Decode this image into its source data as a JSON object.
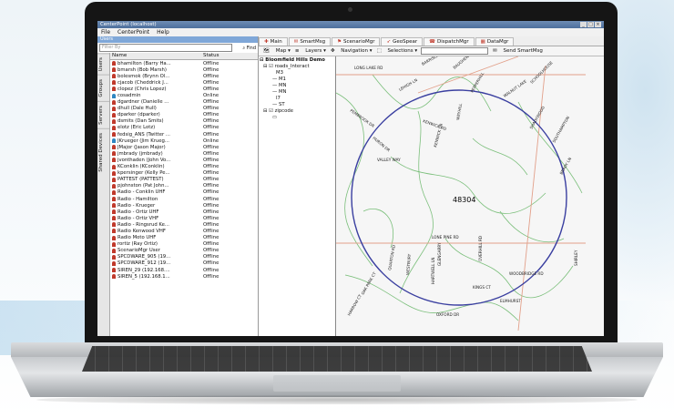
{
  "window": {
    "title": "CenterPoint (localhost)"
  },
  "menu": [
    "File",
    "CenterPoint",
    "Help"
  ],
  "left_panel": {
    "header": "Users",
    "search_placeholder": "Filter By",
    "find_label": "Find",
    "side_tabs": [
      "Users",
      "Groups",
      "Servers",
      "Shared Devices"
    ],
    "columns": [
      "Name",
      "Status"
    ],
    "users": [
      {
        "name": "bhamilton (Barry Ha...",
        "status": "Offline"
      },
      {
        "name": "bmarsh (Bob Marsh)",
        "status": "Offline"
      },
      {
        "name": "bolesmok (Brynn Ol...",
        "status": "Offline"
      },
      {
        "name": "cjacob (Cheddrick J...",
        "status": "Offline"
      },
      {
        "name": "clopez (Chris Lopez)",
        "status": "Offline"
      },
      {
        "name": "cosadmin",
        "status": "Online"
      },
      {
        "name": "dgardner (Danielle ...",
        "status": "Offline"
      },
      {
        "name": "dhull (Dale Hull)",
        "status": "Offline"
      },
      {
        "name": "dparker (dparker)",
        "status": "Offline"
      },
      {
        "name": "dsmits (Dan Smits)",
        "status": "Offline"
      },
      {
        "name": "elotz (Eric Lotz)",
        "status": "Offline"
      },
      {
        "name": "fedsig_ANS (Twitter ...",
        "status": "Offline"
      },
      {
        "name": "JKrueger (Jim Krueg...",
        "status": "Online"
      },
      {
        "name": "JMajor (Jason Major)",
        "status": "Offline"
      },
      {
        "name": "jmbrady (jmbrady)",
        "status": "Offline"
      },
      {
        "name": "jvonthaden (John Vo...",
        "status": "Offline"
      },
      {
        "name": "KConklin (KConklin)",
        "status": "Offline"
      },
      {
        "name": "kpersinger (Kelly Pe...",
        "status": "Offline"
      },
      {
        "name": "PATTEST (PATTEST)",
        "status": "Offline"
      },
      {
        "name": "pjohnston (Pat John...",
        "status": "Offline"
      },
      {
        "name": "Radio - Conklin UHF",
        "status": "Offline"
      },
      {
        "name": "Radio - Hamilton",
        "status": "Offline"
      },
      {
        "name": "Radio - Krueger",
        "status": "Offline"
      },
      {
        "name": "Radio - Ortiz UHF",
        "status": "Offline"
      },
      {
        "name": "Radio - Ortiz VHF",
        "status": "Offline"
      },
      {
        "name": "Radio - Ringsrud Ke...",
        "status": "Offline"
      },
      {
        "name": "Radio Kenwood VHF",
        "status": "Offline"
      },
      {
        "name": "Radio Moto UHF",
        "status": "Offline"
      },
      {
        "name": "rortiz (Ray Ortiz)",
        "status": "Offline"
      },
      {
        "name": "ScenarioMgr User",
        "status": "Offline"
      },
      {
        "name": "SPCDWARE_905 (19...",
        "status": "Offline"
      },
      {
        "name": "SPCDWARE_912 (19...",
        "status": "Offline"
      },
      {
        "name": "SIREN_29 (192.168....",
        "status": "Offline"
      },
      {
        "name": "SIREN_5 (192.168.1...",
        "status": "Offline"
      }
    ]
  },
  "tabs": [
    "Main",
    "SmartMsg",
    "ScenarioMgr",
    "GeoSpear",
    "DispatchMgr",
    "DataMgr"
  ],
  "toolbar": {
    "map": "Map",
    "layers": "Layers",
    "navigation": "Navigation",
    "selections": "Selections",
    "send": "Send SmartMsg"
  },
  "layers": [
    "Bloomfield Hills Demo",
    "roads_Interact",
    "M3",
    "M1",
    "MN",
    "MN",
    "I7",
    "ST",
    "zipcode"
  ],
  "map": {
    "zip": "48304",
    "labels": [
      "LONG LAKE RD",
      "BARRISON LN",
      "BAUGHEN CT",
      "SCHOOLHOUSE",
      "LEHIGH LN",
      "PEPPERHILL",
      "WALNUT LAKE",
      "PEMBROOK DR",
      "KENWICK RD",
      "WEYHILL",
      "HURON DR",
      "KENWICK DR",
      "SHADYWOOD",
      "SOUTHAMPTON",
      "VALLEY WAY",
      "BRADY LN",
      "LONE PINE RD",
      "QUARTON RD",
      "OAK PARK CT",
      "HARROW CT",
      "WESTBURY",
      "WOODBRIDGE RD",
      "HARTWELL LN",
      "OXFORD DR",
      "OVERHILL RD",
      "ELMHURST",
      "GLENGARRY",
      "KINGS CT",
      "SHIRLEY"
    ],
    "colors": {
      "road": "#e2a08a",
      "stream": "#7bbf7b",
      "circle": "#3a3fa0",
      "bg": "#f6f6f6"
    }
  }
}
